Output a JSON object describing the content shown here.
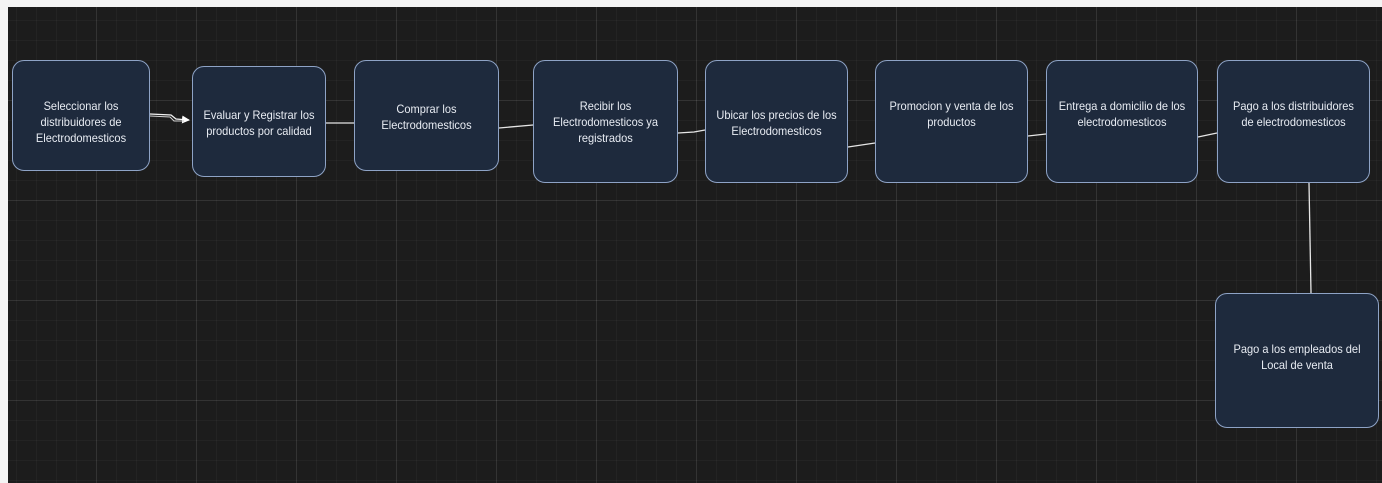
{
  "diagram": {
    "nodes": [
      {
        "id": "n1",
        "label": "Seleccionar los distribuidores de Electrodomesticos"
      },
      {
        "id": "n2",
        "label": "Evaluar y Registrar los productos por calidad"
      },
      {
        "id": "n3",
        "label": "Comprar los Electrodomesticos"
      },
      {
        "id": "n4",
        "label": "Recibir los Electrodomesticos ya registrados"
      },
      {
        "id": "n5",
        "label": "Ubicar los precios de los Electrodomesticos"
      },
      {
        "id": "n6",
        "label": "Promocion y venta de los productos"
      },
      {
        "id": "n7",
        "label": "Entrega a domicilio de los electrodomesticos"
      },
      {
        "id": "n8",
        "label": "Pago a los distribuidores de electrodomesticos"
      },
      {
        "id": "n9",
        "label": "Pago a los empleados del Local de venta"
      }
    ],
    "edges": [
      {
        "from": "n1",
        "to": "n2",
        "arrow": true
      },
      {
        "from": "n2",
        "to": "n3",
        "arrow": false
      },
      {
        "from": "n3",
        "to": "n4",
        "arrow": false
      },
      {
        "from": "n4",
        "to": "n5",
        "arrow": false
      },
      {
        "from": "n5",
        "to": "n6",
        "arrow": false
      },
      {
        "from": "n6",
        "to": "n7",
        "arrow": false
      },
      {
        "from": "n7",
        "to": "n8",
        "arrow": false
      },
      {
        "from": "n8",
        "to": "n9",
        "arrow": false
      }
    ]
  },
  "colors": {
    "canvas": "#1c1c1c",
    "node_fill": "#1e2a3d",
    "node_border": "#8ea3c6",
    "text": "#e8ecf3",
    "edge": "#e6e6e6"
  }
}
